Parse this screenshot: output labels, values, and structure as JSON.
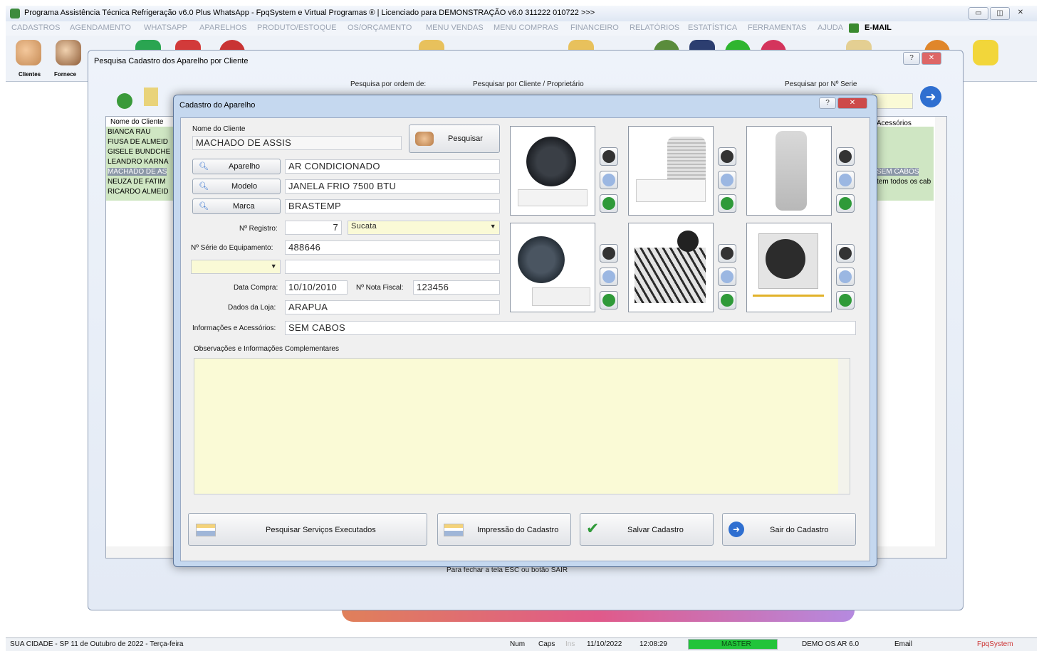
{
  "app": {
    "title": "Programa Assistência Técnica Refrigeração v6.0 Plus WhatsApp - FpqSystem e Virtual Programas ® | Licenciado para  DEMONSTRAÇÃO v6.0 311222 010722 >>>",
    "menu": [
      "CADASTROS",
      "AGENDAMENTO",
      "WHATSAPP",
      "APARELHOS",
      "PRODUTO/ESTOQUE",
      "OS/ORÇAMENTO",
      "MENU VENDAS",
      "MENU COMPRAS",
      "FINANCEIRO",
      "RELATÓRIOS",
      "ESTATÍSTICA",
      "FERRAMENTAS",
      "AJUDA",
      "E-MAIL"
    ],
    "toolbar_left": [
      "Clientes",
      "Fornece"
    ]
  },
  "search_window": {
    "title": "Pesquisa Cadastro dos Aparelho por Cliente",
    "order_label": "Pesquisa por ordem de:",
    "client_label": "Pesquisar por Cliente / Proprietário",
    "serial_label": "Pesquisar por Nº Serie",
    "list_header": "Nome do Cliente",
    "list_header_right": "Acessórios",
    "clients": [
      "BIANCA RAU",
      "FIUSA DE ALMEID",
      "GISELE BUNDCHE",
      "LEANDRO KARNA",
      "MACHADO DE AS",
      "NEUZA DE FATIM",
      "RICARDO ALMEID"
    ],
    "acc_values": [
      "SEM CABOS",
      "tem todos os cab"
    ],
    "hint": "Para fechar a tela ESC ou botão SAIR"
  },
  "dialog": {
    "title": "Cadastro do Aparelho",
    "client_label": "Nome do Cliente",
    "client_value": "MACHADO DE ASSIS",
    "search_btn": "Pesquisar",
    "aparelho_btn": "Aparelho",
    "aparelho_value": "AR CONDICIONADO",
    "modelo_btn": "Modelo",
    "modelo_value": "JANELA FRIO 7500 BTU",
    "marca_btn": "Marca",
    "marca_value": "BRASTEMP",
    "registro_label": "Nº Registro:",
    "registro_value": "7",
    "status_value": "Sucata",
    "serie_label": "Nº Série do Equipamento:",
    "serie_value": "488646",
    "data_compra_label": "Data Compra:",
    "data_compra_value": "10/10/2010",
    "nota_label": "Nº Nota Fiscal:",
    "nota_value": "123456",
    "loja_label": "Dados da Loja:",
    "loja_value": "ARAPUA",
    "info_label": "Informações e Acessórios:",
    "info_value": "SEM CABOS",
    "obs_label": "Observações e Informações Complementares",
    "buttons": {
      "servicos": "Pesquisar Serviços Executados",
      "impressao": "Impressão do Cadastro",
      "salvar": "Salvar Cadastro",
      "sair": "Sair do Cadastro"
    }
  },
  "status": {
    "city": "SUA CIDADE - SP 11 de Outubro de 2022 - Terça-feira",
    "num": "Num",
    "caps": "Caps",
    "ins": "Ins",
    "date": "11/10/2022",
    "time": "12:08:29",
    "user": "MASTER",
    "demo": "DEMO OS AR 6.0",
    "email": "Email",
    "brand": "FpqSystem"
  },
  "colors": {
    "accent": "#3a7fd3",
    "obs_bg": "#fafad6",
    "master_green": "#22c43a"
  }
}
